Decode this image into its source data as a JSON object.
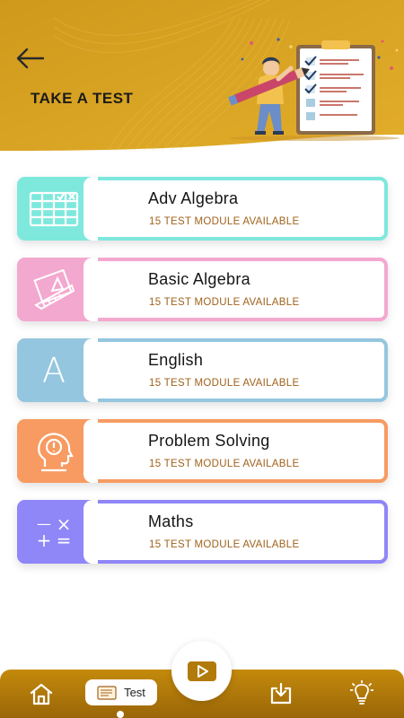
{
  "header": {
    "title": "TAKE A TEST"
  },
  "cards": [
    {
      "title": "Adv Algebra",
      "subtitle": "15 TEST MODULE AVAILABLE",
      "color": "#7ee8dd",
      "icon": "table-grid-icon"
    },
    {
      "title": "Basic Algebra",
      "subtitle": "15 TEST MODULE AVAILABLE",
      "color": "#f3a8cf",
      "icon": "geometry-tools-icon"
    },
    {
      "title": "English",
      "subtitle": "15 TEST MODULE AVAILABLE",
      "color": "#95c6df",
      "icon": "letter-a-icon"
    },
    {
      "title": "Problem Solving",
      "subtitle": "15 TEST MODULE AVAILABLE",
      "color": "#f79b62",
      "icon": "idea-head-icon"
    },
    {
      "title": "Maths",
      "subtitle": "15 TEST MODULE AVAILABLE",
      "color": "#8f86f8",
      "icon": "math-operators-icon"
    }
  ],
  "math_icon": {
    "minus": "—",
    "times": "×",
    "plus": "+",
    "equals": "="
  },
  "english_icon_letter": "A",
  "nav": {
    "test_label": "Test"
  },
  "colors": {
    "header_gold": "#d9a420",
    "nav_gold": "#b27a0a",
    "subtitle": "#a0621b"
  }
}
